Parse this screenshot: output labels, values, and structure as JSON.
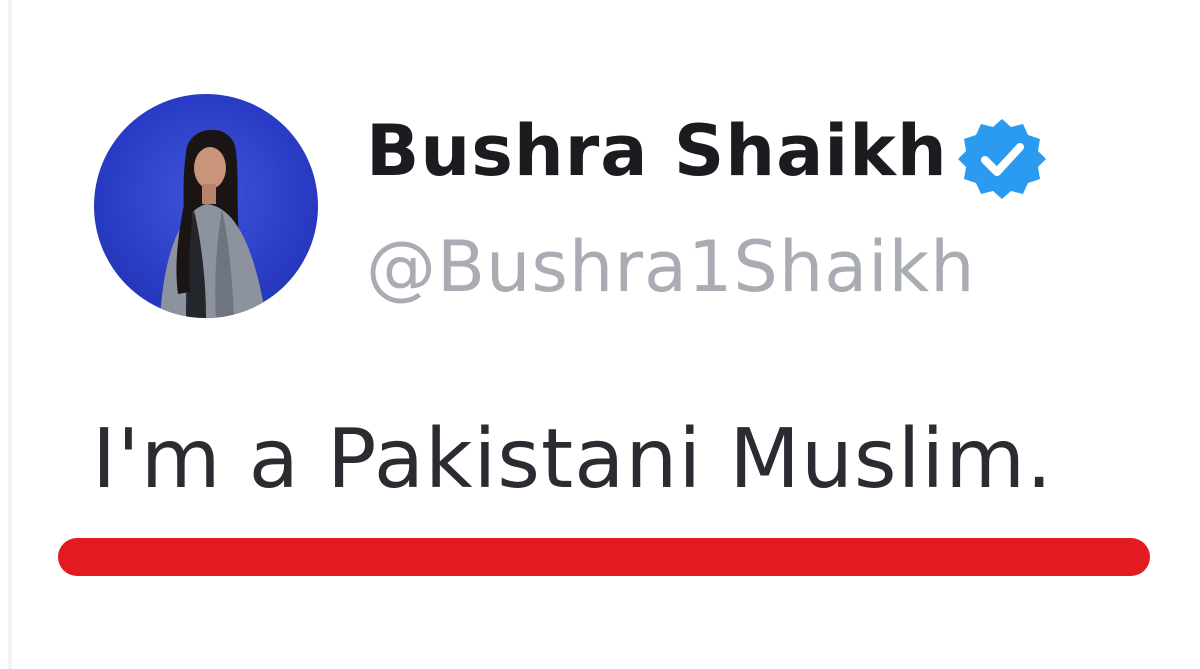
{
  "tweet": {
    "display_name": "Bushra Shaikh",
    "handle": "@Bushra1Shaikh",
    "text": "I'm a Pakistani Muslim.",
    "verified": true
  },
  "icons": {
    "verified": "verified-badge-icon",
    "avatar": "profile-photo"
  },
  "colors": {
    "verified_badge": "#2a9bf0",
    "highlight_underline": "#e21b22",
    "avatar_background": "#2a3dc7",
    "name_text": "#1b1c1f",
    "handle_text": "#a9adb3"
  }
}
